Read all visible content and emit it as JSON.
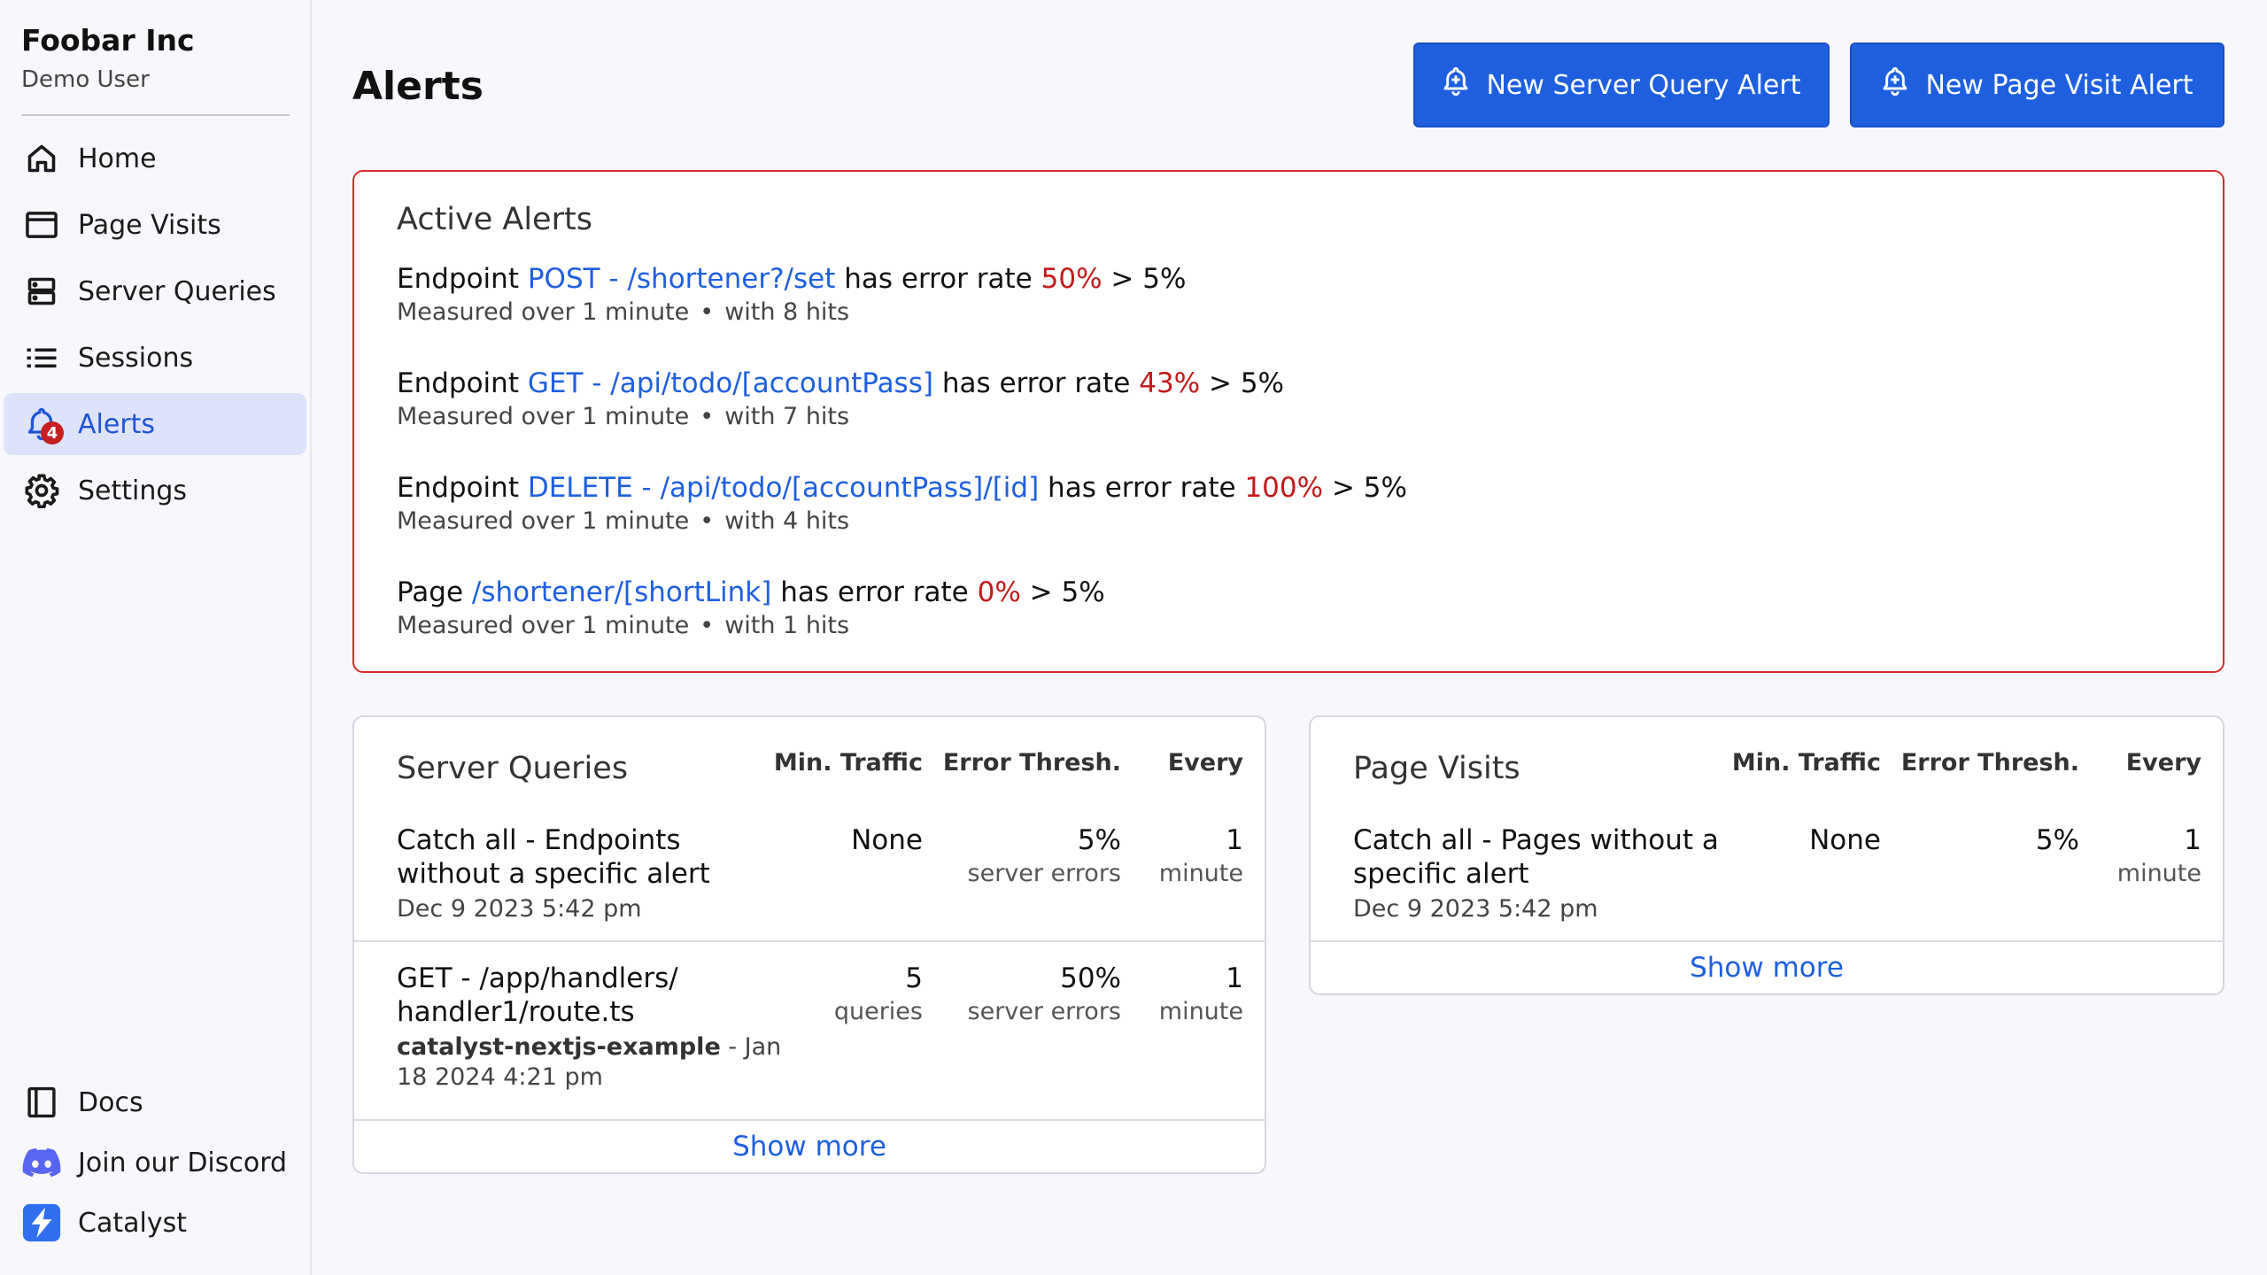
{
  "sidebar": {
    "org_name": "Foobar Inc",
    "user_name": "Demo User",
    "nav": [
      {
        "label": "Home",
        "icon": "home-icon"
      },
      {
        "label": "Page Visits",
        "icon": "window-icon"
      },
      {
        "label": "Server Queries",
        "icon": "server-icon"
      },
      {
        "label": "Sessions",
        "icon": "list-icon"
      },
      {
        "label": "Alerts",
        "icon": "bell-icon",
        "active": true,
        "badge": "4"
      },
      {
        "label": "Settings",
        "icon": "gear-icon"
      }
    ],
    "bottom": [
      {
        "label": "Docs",
        "icon": "book-icon"
      },
      {
        "label": "Join our Discord",
        "icon": "discord-icon"
      },
      {
        "label": "Catalyst",
        "icon": "catalyst-logo-icon"
      }
    ]
  },
  "header": {
    "title": "Alerts",
    "new_server_query_alert": "New Server Query Alert",
    "new_page_visit_alert": "New Page Visit Alert"
  },
  "active_alerts": {
    "title": "Active Alerts",
    "items": [
      {
        "kind": "Endpoint",
        "target": "POST - /shortener?/set",
        "text": "has error rate",
        "rate": "50%",
        "threshold": "> 5%",
        "window": "Measured over 1 minute",
        "hits": "with 8 hits"
      },
      {
        "kind": "Endpoint",
        "target": "GET - /api/todo/[accountPass]",
        "text": "has error rate",
        "rate": "43%",
        "threshold": "> 5%",
        "window": "Measured over 1 minute",
        "hits": "with 7 hits"
      },
      {
        "kind": "Endpoint",
        "target": "DELETE - /api/todo/[accountPass]/[id]",
        "text": "has error rate",
        "rate": "100%",
        "threshold": "> 5%",
        "window": "Measured over 1 minute",
        "hits": "with 4 hits"
      },
      {
        "kind": "Page",
        "target": "/shortener/[shortLink]",
        "text": "has error rate",
        "rate": "0%",
        "threshold": "> 5%",
        "window": "Measured over 1 minute",
        "hits": "with 1 hits"
      }
    ],
    "bullet": "•"
  },
  "server_queries": {
    "title": "Server Queries",
    "columns": [
      "Min. Traffic",
      "Error Thresh.",
      "Every"
    ],
    "rows": [
      {
        "name_line1": "Catch all - Endpoints",
        "name_line2": "without a specific alert",
        "meta_bold": "",
        "meta": "Dec 9 2023 5:42 pm",
        "traffic": "None",
        "traffic_unit": "",
        "thresh": "5%",
        "thresh_unit": "server errors",
        "every": "1",
        "every_unit": "minute"
      },
      {
        "name_line1": "GET - /app/handlers/",
        "name_line2": "handler1/route.ts",
        "meta_bold": "catalyst-nextjs-example",
        "meta_line1": " - Jan",
        "meta": "18 2024 4:21 pm",
        "traffic": "5",
        "traffic_unit": "queries",
        "thresh": "50%",
        "thresh_unit": "server errors",
        "every": "1",
        "every_unit": "minute"
      }
    ],
    "show_more": "Show more"
  },
  "page_visits": {
    "title": "Page Visits",
    "columns": [
      "Min. Traffic",
      "Error Thresh.",
      "Every"
    ],
    "rows": [
      {
        "name_line1": "Catch all - Pages without a",
        "name_line2": "specific alert",
        "meta": "Dec 9 2023 5:42 pm",
        "traffic": "None",
        "thresh": "5%",
        "every": "1",
        "every_unit": "minute"
      }
    ],
    "show_more": "Show more"
  },
  "colors": {
    "accent": "#1e5fe0",
    "error": "#c41a1a",
    "active_border": "#d92b2b",
    "active_nav_bg": "#dde3fb"
  }
}
